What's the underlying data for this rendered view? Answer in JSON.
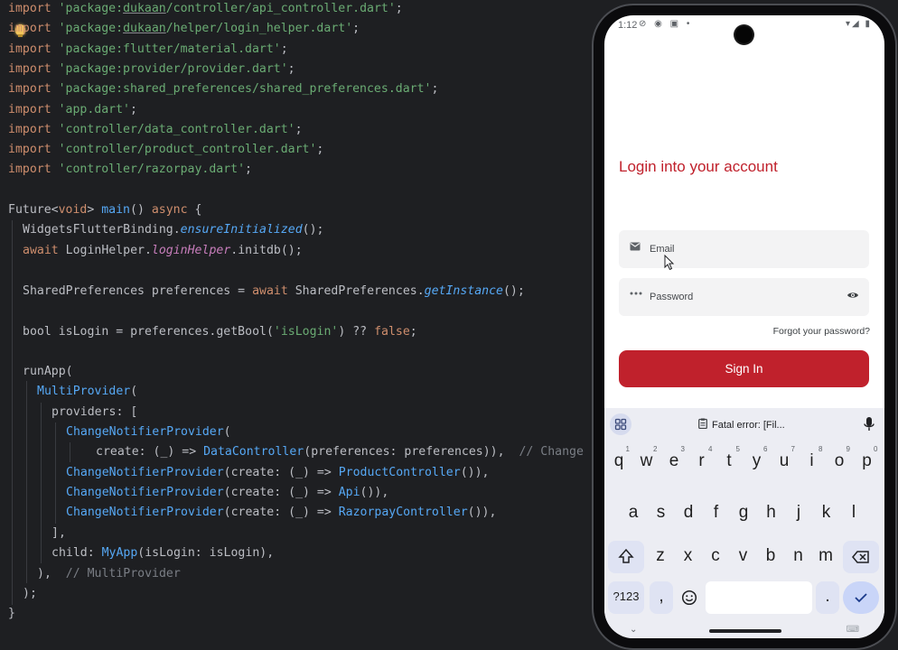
{
  "editor": {
    "imports": [
      {
        "pre": "'package:",
        "ul": "dukaan",
        "post": "/controller/api_controller.dart'"
      },
      {
        "pre": "'package:",
        "ul": "dukaan",
        "post": "/helper/login_helper.dart'"
      },
      {
        "pre": "'package:flutter/material.dart'",
        "ul": "",
        "post": ""
      },
      {
        "pre": "'package:provider/provider.dart'",
        "ul": "",
        "post": ""
      },
      {
        "pre": "'package:shared_preferences/shared_preferences.dart'",
        "ul": "",
        "post": ""
      },
      {
        "pre": "'app.dart'",
        "ul": "",
        "post": ""
      },
      {
        "pre": "'controller/data_controller.dart'",
        "ul": "",
        "post": ""
      },
      {
        "pre": "'controller/product_controller.dart'",
        "ul": "",
        "post": ""
      },
      {
        "pre": "'controller/razorpay.dart'",
        "ul": "",
        "post": ""
      }
    ],
    "import_kw": "import",
    "semicolon": ";",
    "future_line": {
      "a": "Future<",
      "b": "void",
      "c": "> ",
      "d": "main",
      "e": "() ",
      "f": "async",
      "g": " {"
    },
    "ensure_line": {
      "a": "WidgetsFlutterBinding.",
      "b": "ensureInitialized",
      "c": "();"
    },
    "initdb_line": {
      "a": "await",
      "b": " LoginHelper.",
      "c": "loginHelper",
      "d": ".initdb();"
    },
    "prefs_line": {
      "a": "SharedPreferences preferences = ",
      "b": "await",
      "c": " SharedPreferences.",
      "d": "getInstance",
      "e": "();"
    },
    "bool_line": {
      "a": "bool isLogin = preferences.getBool(",
      "b": "'isLogin'",
      "c": ") ?? ",
      "d": "false",
      "e": ";"
    },
    "runapp_line": "runApp(",
    "multiprovider_line": {
      "a": "MultiProvider",
      "b": "("
    },
    "providers_line": "providers: [",
    "cnp1_line": {
      "a": "ChangeNotifierProvider",
      "b": "("
    },
    "create1_line": {
      "a": "create: (_) => ",
      "b": "DataController",
      "c": "(preferences: preferences)),  ",
      "d": "// Change"
    },
    "cnp2_line": {
      "a": "ChangeNotifierProvider",
      "b": "(create: (_) => ",
      "c": "ProductController",
      "d": "()),"
    },
    "cnp3_line": {
      "a": "ChangeNotifierProvider",
      "b": "(create: (_) => ",
      "c": "Api",
      "d": "()),"
    },
    "cnp4_line": {
      "a": "ChangeNotifierProvider",
      "b": "(create: (_) => ",
      "c": "RazorpayController",
      "d": "()),"
    },
    "close_bracket": "],",
    "child_line": {
      "a": "child: ",
      "b": "MyApp",
      "c": "(isLogin: isLogin),"
    },
    "close_multi": {
      "a": "),  ",
      "b": "// MultiProvider"
    },
    "close_run": ");",
    "close_brace": "}"
  },
  "phone": {
    "status": {
      "time": "1:12",
      "icons": "⊘ ◉ ▣ •",
      "right": "▾◢ ▮"
    },
    "title": "Login into your account",
    "email_placeholder": "Email",
    "password_placeholder": "Password",
    "forgot": "Forgot your password?",
    "signin": "Sign In",
    "keyboard": {
      "clipboard": "Fatal error: [Fil...",
      "row1": [
        "q",
        "w",
        "e",
        "r",
        "t",
        "y",
        "u",
        "i",
        "o",
        "p"
      ],
      "row1_hints": [
        "1",
        "2",
        "3",
        "4",
        "5",
        "6",
        "7",
        "8",
        "9",
        "0"
      ],
      "row2": [
        "a",
        "s",
        "d",
        "f",
        "g",
        "h",
        "j",
        "k",
        "l"
      ],
      "row3": [
        "z",
        "x",
        "c",
        "v",
        "b",
        "n",
        "m"
      ],
      "sym_key": "?123",
      "comma": ",",
      "period": "."
    }
  },
  "colors": {
    "accent": "#c0212c",
    "editor_bg": "#1e1f22"
  }
}
